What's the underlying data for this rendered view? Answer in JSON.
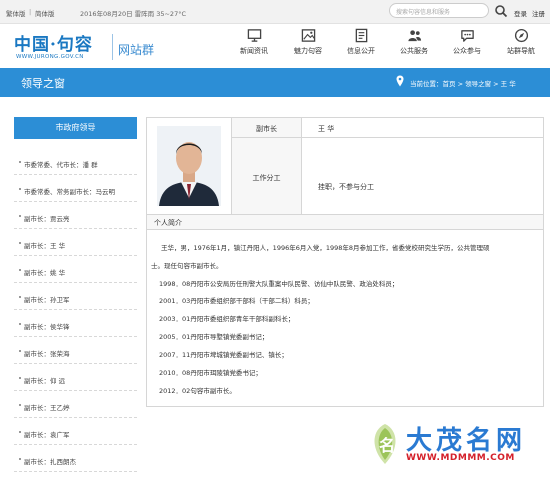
{
  "topbar": {
    "lang_traditional": "繁体版",
    "lang_simplified": "简体版",
    "date_weather": "2016年08月20日  雷阵雨 35~27°C",
    "search_placeholder": "搜索句容信息和服务",
    "login": "登录",
    "register": "注册"
  },
  "header": {
    "logo_cn": "中国·句容",
    "logo_en": "WWW.JURONG.GOV.CN",
    "logo_sub": "网站群",
    "nav": [
      {
        "label": "新闻资讯",
        "icon": "monitor-icon"
      },
      {
        "label": "魅力句容",
        "icon": "photo-icon"
      },
      {
        "label": "信息公开",
        "icon": "document-icon"
      },
      {
        "label": "公共服务",
        "icon": "people-icon"
      },
      {
        "label": "公众参与",
        "icon": "chat-icon"
      },
      {
        "label": "站群导航",
        "icon": "compass-icon"
      }
    ]
  },
  "bluebar": {
    "title": "领导之窗",
    "breadcrumb": "当前位置：首页 > 领导之窗 > 王  华"
  },
  "sidebar": {
    "heading": "市政府领导",
    "items": [
      "市委常委、代市长：潘  群",
      "市委常委、常务副市长：马云明",
      "副市长：贾云亮",
      "副市长：王  华",
      "副市长：姚  华",
      "副市长：孙卫军",
      "副市长：侯华锋",
      "副市长：张荣海",
      "副市长：仰  远",
      "副市长：王乙婷",
      "副市长：袁广军",
      "副市长：扎西朗杰"
    ]
  },
  "profile": {
    "position_label": "副市长",
    "name": "王  华",
    "duty_label": "工作分工",
    "duty": "挂职，不参与分工",
    "intro_heading": "个人简介",
    "bio": [
      "王华，男，1976年1月，镇江丹阳人，1996年6月入党，1998年8月参加工作，省委党校研究生学历，公共管理硕",
      "士。现任句容市副市长。",
      "1998．08丹阳市公安局历任刑警大队重案中队民警、访仙中队民警、政治处科员；",
      "2001．03丹阳市委组织部干部科（干部二科）科员；",
      "2003．01丹阳市委组织部青年干部科副科长；",
      "2005．01丹阳市导墅镇党委副书记；",
      "2007．11丹阳市埤城镇党委副书记、镇长；",
      "2010．08丹阳市珥陵镇党委书记；",
      "2012．02句容市副市长。"
    ]
  },
  "watermark": {
    "text": "大茂名网",
    "url": "WWW.MDMMM.COM"
  },
  "colors": {
    "brand_blue": "#2c8ed6",
    "watermark_red": "#d4202a"
  }
}
